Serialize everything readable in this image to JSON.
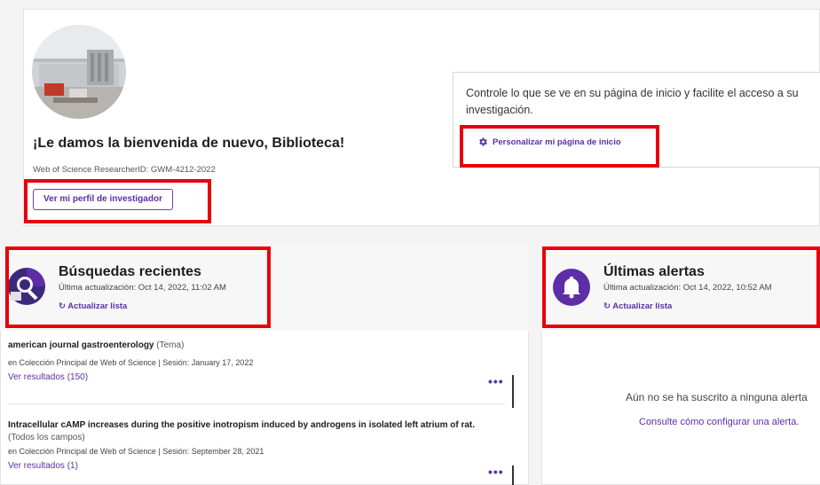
{
  "profile": {
    "welcome": "¡Le damos la bienvenida de nuevo, Biblioteca!",
    "researcher_id": "Web of Science ResearcherID: GWM-4212-2022",
    "profile_button": "Ver mi perfil de investigador"
  },
  "customize": {
    "description": "Controle lo que se ve en su página de inicio y facilite el acceso a su investigación.",
    "link": "Personalizar mi página de inicio",
    "icon": "gear-icon"
  },
  "recent_searches": {
    "title": "Búsquedas recientes",
    "updated": "Última actualización: Oct 14, 2022, 11:02 AM",
    "refresh": "Actualizar lista",
    "icon": "search-history-icon",
    "items": [
      {
        "query": "american journal gastroenterology",
        "field": "(Tema)",
        "meta": "en Colección Principal de Web of Science | Sesión: January 17, 2022",
        "results": "Ver resultados (150)"
      },
      {
        "query": "Intracellular cAMP increases during the positive inotropism induced by androgens in isolated left atrium of rat.",
        "field": "(Todos los campos)",
        "meta": "en Colección Principal de Web of Science | Sesión: September 28, 2021",
        "results": "Ver resultados (1)"
      }
    ],
    "more": "•••"
  },
  "alerts": {
    "title": "Últimas alertas",
    "updated": "Última actualización: Oct 14, 2022, 10:52 AM",
    "refresh": "Actualizar lista",
    "icon": "bell-icon",
    "empty_message": "Aún no se ha suscrito a ninguna alerta",
    "help_link": "Consulte cómo configurar una alerta."
  },
  "colors": {
    "accent": "#5d2ea8",
    "highlight_box": "#e8000b"
  }
}
